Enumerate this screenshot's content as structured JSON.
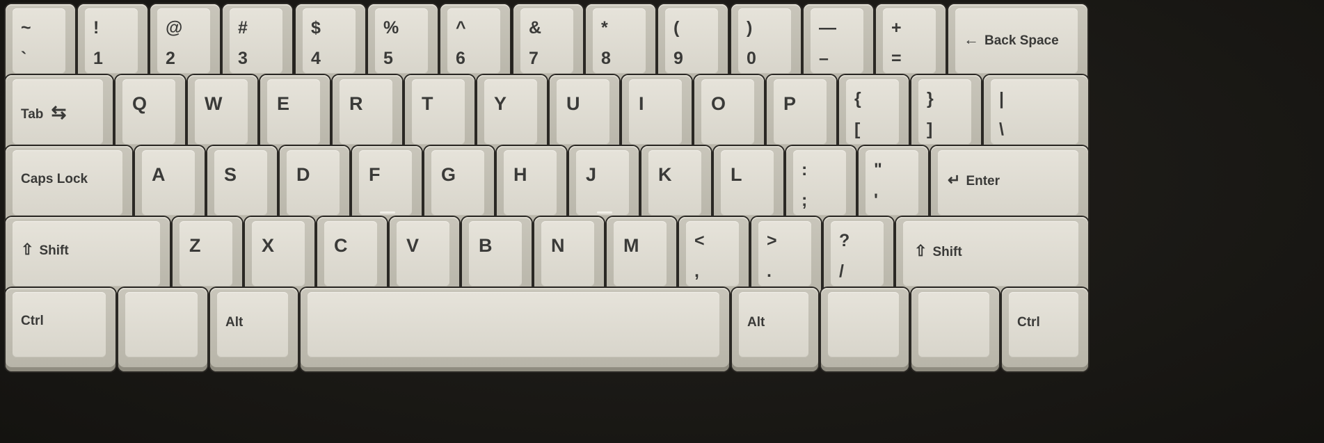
{
  "keyboard": {
    "row1": [
      {
        "top": "~",
        "bottom": "`"
      },
      {
        "top": "!",
        "bottom": "1"
      },
      {
        "top": "@",
        "bottom": "2"
      },
      {
        "top": "#",
        "bottom": "3"
      },
      {
        "top": "$",
        "bottom": "4"
      },
      {
        "top": "%",
        "bottom": "5"
      },
      {
        "top": "^",
        "bottom": "6"
      },
      {
        "top": "&",
        "bottom": "7"
      },
      {
        "top": "*",
        "bottom": "8"
      },
      {
        "top": "(",
        "bottom": "9"
      },
      {
        "top": ")",
        "bottom": "0"
      },
      {
        "top": "—",
        "bottom": "–"
      },
      {
        "top": "+",
        "bottom": "="
      }
    ],
    "backspace": {
      "icon": "←",
      "label": "Back Space"
    },
    "tab": {
      "label": "Tab",
      "icon": "⇆"
    },
    "row2": [
      "Q",
      "W",
      "E",
      "R",
      "T",
      "Y",
      "U",
      "I",
      "O",
      "P"
    ],
    "row2_symbols": [
      {
        "top": "{",
        "bottom": "["
      },
      {
        "top": "}",
        "bottom": "]"
      },
      {
        "top": "|",
        "bottom": "\\"
      }
    ],
    "capslock": {
      "label": "Caps Lock"
    },
    "row3": [
      "A",
      "S",
      "D",
      "F",
      "G",
      "H",
      "J",
      "K",
      "L"
    ],
    "row3_symbols": [
      {
        "top": ":",
        "bottom": ";"
      },
      {
        "top": "\"",
        "bottom": "'"
      }
    ],
    "enter": {
      "icon": "↵",
      "label": "Enter"
    },
    "shift_left": {
      "icon": "⇧",
      "label": "Shift"
    },
    "row4": [
      "Z",
      "X",
      "C",
      "V",
      "B",
      "N",
      "M"
    ],
    "row4_symbols": [
      {
        "top": "<",
        "bottom": ","
      },
      {
        "top": ">",
        "bottom": "."
      },
      {
        "top": "?",
        "bottom": "/"
      }
    ],
    "shift_right": {
      "icon": "⇧",
      "label": "Shift"
    },
    "ctrl_left": {
      "label": "Ctrl"
    },
    "alt_left": {
      "label": "Alt"
    },
    "alt_right": {
      "label": "Alt"
    },
    "ctrl_right": {
      "label": "Ctrl"
    }
  }
}
